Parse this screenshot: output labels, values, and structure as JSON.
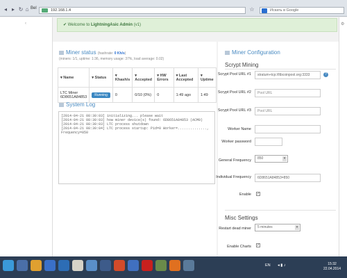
{
  "browser": {
    "left_label": "Bel",
    "address": "192.168.1.4",
    "search_placeholder": "Искать в Google"
  },
  "alert": {
    "prefix": "Welcome to ",
    "brand": "LightningAsic Admin",
    "suffix": " (v1)"
  },
  "miner_status": {
    "title": "Miner status",
    "hashrate_label": "(hashrate: ",
    "hashrate_value": "0 Kh/s",
    "hashrate_close": ")",
    "subtitle": "(miners: 1/1, uptime: 1:36, memory usage: 37%, load average: 0.02)",
    "columns": [
      "Name",
      "Status",
      "Khash/s",
      "Accepted",
      "HW Errors",
      "Last Accepted",
      "Uptime"
    ],
    "rows": [
      {
        "name": "LTC Miner 6D8651A84853",
        "status": "Running",
        "khash": "0",
        "accepted": "0/10 (0%)",
        "hw": "0",
        "last": "1:49 ago",
        "uptime": "1:49"
      }
    ]
  },
  "system_log": {
    "title": "System Log",
    "lines": [
      "[2014-04-21 08:30:03] initializing... please wait",
      "[2014-04-21 08:30:03] how miner device(s) found: 6D8651A84853 (ACM0)",
      "[2014-04-21 08:30:03] LTC process shutdown",
      "[2014-04-21 08:30:04] LTC process startup: Pid=0 Worker=..............,",
      "Frequency=850"
    ]
  },
  "miner_config": {
    "title": "Miner Configuration",
    "section": "Scrypt Mining",
    "fields": [
      {
        "label": "Scrypt Pool URL #1",
        "value": "stratum+tcp://ltbcoinpool.org:3333",
        "placeholder": ""
      },
      {
        "label": "Scrypt Pool URL #2",
        "value": "",
        "placeholder": "Pool URL"
      },
      {
        "label": "Scrypt Pool URL #3",
        "value": "",
        "placeholder": "Pool URL"
      },
      {
        "label": "Worker Name",
        "value": "",
        "placeholder": ""
      },
      {
        "label": "Worker password",
        "value": "",
        "placeholder": ""
      }
    ],
    "frequency_label": "General Frequency",
    "frequency_value": "850",
    "individual_label": "Individual Frequency",
    "individual_value": "6D8651A84853=850",
    "enable_label": "Enable",
    "enable_checked": "✓",
    "help": "?",
    "misc_title": "Misc Settings",
    "restart_label": "Restart dead miner",
    "restart_value": "5 minutes",
    "charts_label": "Enable Charts",
    "charts_checked": "✓"
  },
  "taskbar": {
    "lang": "EN",
    "time": "15:32",
    "date": "22.04.2014"
  },
  "colors": {
    "accent": "#4a8bc2",
    "success_bg": "#dff0d8",
    "success_text": "#3c763d",
    "taskbar": "#2c3e55"
  }
}
